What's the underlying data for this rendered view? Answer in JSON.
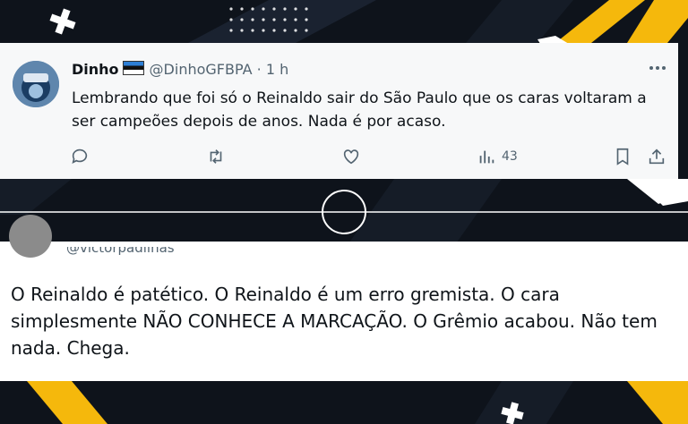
{
  "tweet1": {
    "name": "Dinho",
    "handle": "@DinhoGFBPA",
    "separator": "·",
    "time": "1 h",
    "more_icon": "more-horizontal-icon",
    "text": "Lembrando que foi só o Reinaldo sair do São Paulo que os caras voltaram a ser campeões depois de anos. Nada é por acaso.",
    "views": "43"
  },
  "tweet2": {
    "handle": "@victorpadilhas",
    "text": "O Reinaldo é patético. O Reinaldo é um erro gremista. O cara simplesmente NÃO CONHECE A MARCAÇÃO. O Grêmio acabou. Não tem nada. Chega."
  },
  "colors": {
    "accent_yellow": "#f5b80c",
    "background": "#0e131b",
    "card": "#ffffff",
    "secondary_text": "#536471"
  }
}
